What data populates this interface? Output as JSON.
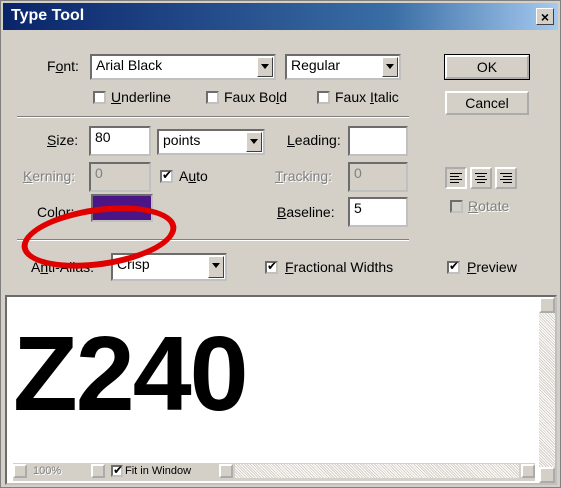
{
  "window": {
    "title": "Type Tool",
    "close_label": "×"
  },
  "font": {
    "label_pre": "F",
    "label_u": "o",
    "label_post": "nt:",
    "family": "Arial Black",
    "style": "Regular",
    "underline": {
      "pre": "",
      "u": "U",
      "post": "nderline",
      "checked": false
    },
    "faux_bold": {
      "pre": "Faux Bo",
      "u": "l",
      "post": "d",
      "checked": false
    },
    "faux_italic": {
      "pre": "Faux ",
      "u": "I",
      "post": "talic",
      "checked": false
    }
  },
  "buttons": {
    "ok": "OK",
    "cancel": "Cancel"
  },
  "size": {
    "label_u": "S",
    "label_post": "ize:",
    "value": "80",
    "unit": "points"
  },
  "leading": {
    "label_u": "L",
    "label_post": "eading:",
    "value": ""
  },
  "kerning": {
    "label_pre": "",
    "label_u": "K",
    "label_post": "erning:",
    "value": "0"
  },
  "auto": {
    "label_pre": "A",
    "label_u": "u",
    "label_post": "to",
    "checked": true
  },
  "tracking": {
    "label_u": "T",
    "label_post": "racking:",
    "value": "0"
  },
  "color": {
    "label": "Color:",
    "swatch": "#4b1585"
  },
  "baseline": {
    "label_u": "B",
    "label_post": "aseline:",
    "value": "5"
  },
  "rotate": {
    "label_u": "R",
    "label_post": "otate",
    "checked": false
  },
  "anti_alias": {
    "label_pre": "A",
    "label_u": "n",
    "label_post": "ti-Alias:",
    "value": "Crisp"
  },
  "fractional_widths": {
    "label_u": "F",
    "label_post": "ractional Widths",
    "checked": true
  },
  "preview_opt": {
    "label_u": "P",
    "label_post": "review",
    "checked": true
  },
  "preview": {
    "text": "Z240"
  },
  "statusbar": {
    "zoom": "100%",
    "fit_label": "Fit in Window",
    "fit_checked": true
  },
  "annotation": {
    "color": "#e00000",
    "shape": "ellipse"
  }
}
